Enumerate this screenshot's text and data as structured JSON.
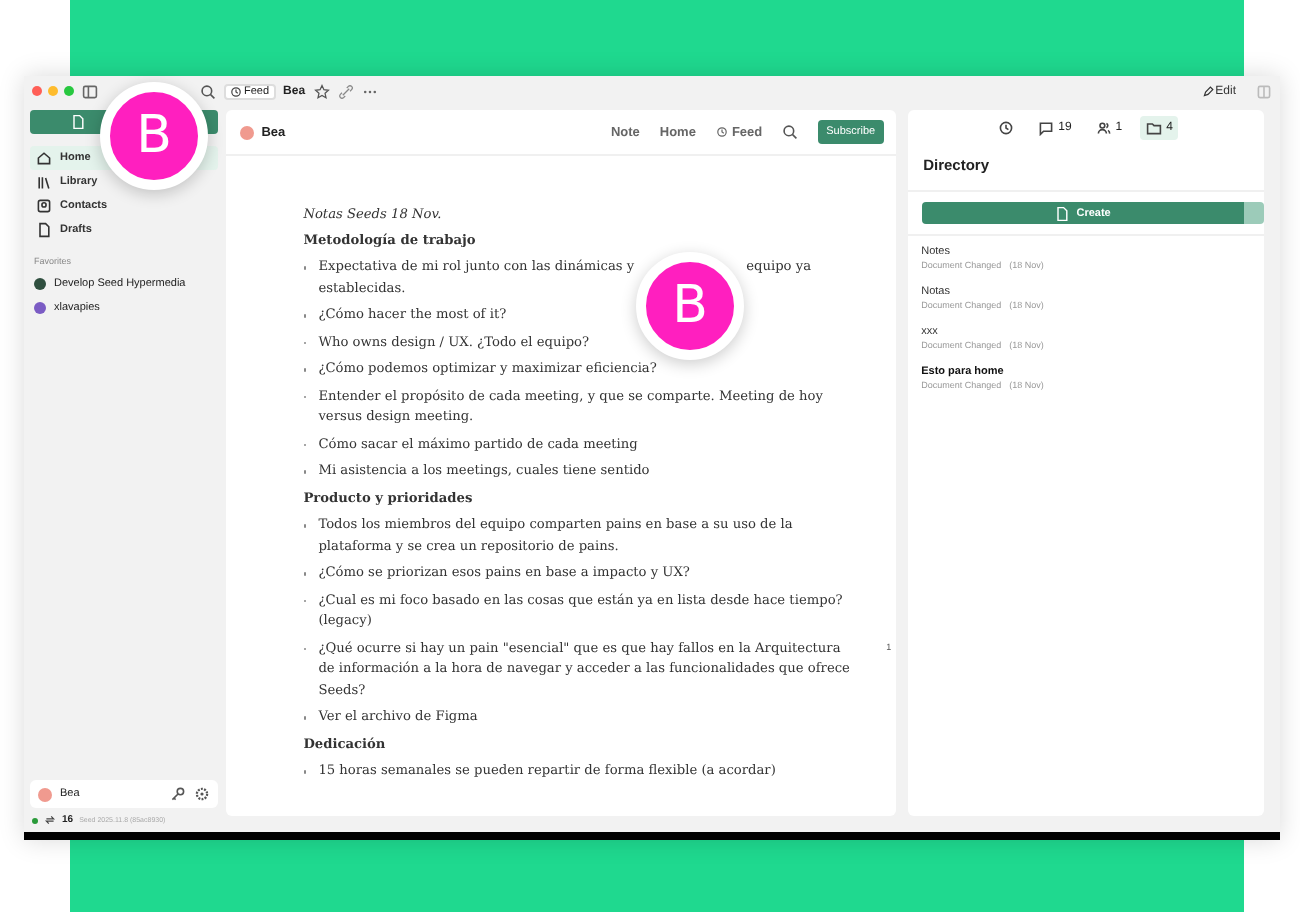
{
  "titlebar": {
    "feed_label": "Feed",
    "title": "Bea",
    "edit_label": "Edit"
  },
  "sidebar": {
    "items": [
      {
        "label": "Home",
        "selected": true
      },
      {
        "label": "Library",
        "selected": false
      },
      {
        "label": "Contacts",
        "selected": false
      },
      {
        "label": "Drafts",
        "selected": false
      }
    ],
    "favorites_heading": "Favorites",
    "favorites": [
      {
        "label": "Develop Seed Hypermedia",
        "color": "#2f4f3f"
      },
      {
        "label": "xlavapies",
        "color": "#7b5cc4"
      }
    ],
    "account": {
      "name": "Bea"
    }
  },
  "status_bar": {
    "count": "16",
    "version": "Seed 2025.11.8 (85ac8930)"
  },
  "document": {
    "author": "Bea",
    "nav": [
      {
        "label": "Note",
        "icon": false
      },
      {
        "label": "Home",
        "icon": false
      },
      {
        "label": "Feed",
        "icon": true
      }
    ],
    "subscribe": "Subscribe",
    "blocks": [
      {
        "kind": "italic",
        "text": "Notas Seeds 18 Nov."
      },
      {
        "kind": "heading",
        "text": "Metodología de trabajo"
      },
      {
        "kind": "bullet",
        "text": "Expectativa de mi rol junto con las dinámicas y",
        "text_after": "equipo ya establecidas."
      },
      {
        "kind": "bullet",
        "text": "¿Cómo hacer the most of it?"
      },
      {
        "kind": "bullet",
        "text": "Who owns design / UX. ¿Todo el equipo?"
      },
      {
        "kind": "bullet",
        "text": "¿Cómo podemos optimizar y maximizar eficiencia?"
      },
      {
        "kind": "bullet",
        "text": "Entender el propósito de cada meeting, y que se comparte. Meeting de hoy versus design meeting."
      },
      {
        "kind": "bullet",
        "text": "Cómo sacar el máximo partido de cada meeting"
      },
      {
        "kind": "bullet",
        "text": "Mi asistencia a los meetings, cuales tiene sentido"
      },
      {
        "kind": "heading",
        "text": "Producto y prioridades"
      },
      {
        "kind": "bullet",
        "text": "Todos los miembros del equipo comparten pains en base a su uso de la plataforma y se crea un repositorio de pains."
      },
      {
        "kind": "bullet",
        "text": "¿Cómo se priorizan esos pains en base a impacto y UX?"
      },
      {
        "kind": "bullet",
        "text": "¿Cual es mi foco basado en las cosas que están ya en lista desde hace tiempo? (legacy)"
      },
      {
        "kind": "bullet",
        "text": "¿Qué ocurre si hay un pain \"esencial\" que es que hay fallos en la Arquitectura de información a la hora de navegar y acceder a las funcionalidades que ofrece Seeds?",
        "comments": "1"
      },
      {
        "kind": "bullet",
        "text": "Ver el archivo de Figma"
      },
      {
        "kind": "heading",
        "text": "Dedicación"
      },
      {
        "kind": "bullet",
        "text": "15 horas semanales se pueden repartir de forma flexible (a acordar)"
      }
    ]
  },
  "panel": {
    "tabs": [
      {
        "selected": false
      },
      {
        "label": "19",
        "selected": false
      },
      {
        "label": "1",
        "selected": false
      },
      {
        "label": "4",
        "selected": true
      }
    ],
    "title": "Directory",
    "create": "Create",
    "docs": [
      {
        "title": "Notes",
        "emphasized": false,
        "meta": "Document Changed",
        "date": "(18 Nov)"
      },
      {
        "title": "Notas",
        "emphasized": false,
        "meta": "Document Changed",
        "date": "(18 Nov)"
      },
      {
        "title": "xxx",
        "emphasized": false,
        "meta": "Document Changed",
        "date": "(18 Nov)"
      },
      {
        "title": "Esto para home",
        "emphasized": true,
        "meta": "Document Changed",
        "date": "(18 Nov)"
      }
    ]
  },
  "avatar_bubbles": [
    {
      "letter": "B"
    },
    {
      "letter": "B"
    }
  ]
}
